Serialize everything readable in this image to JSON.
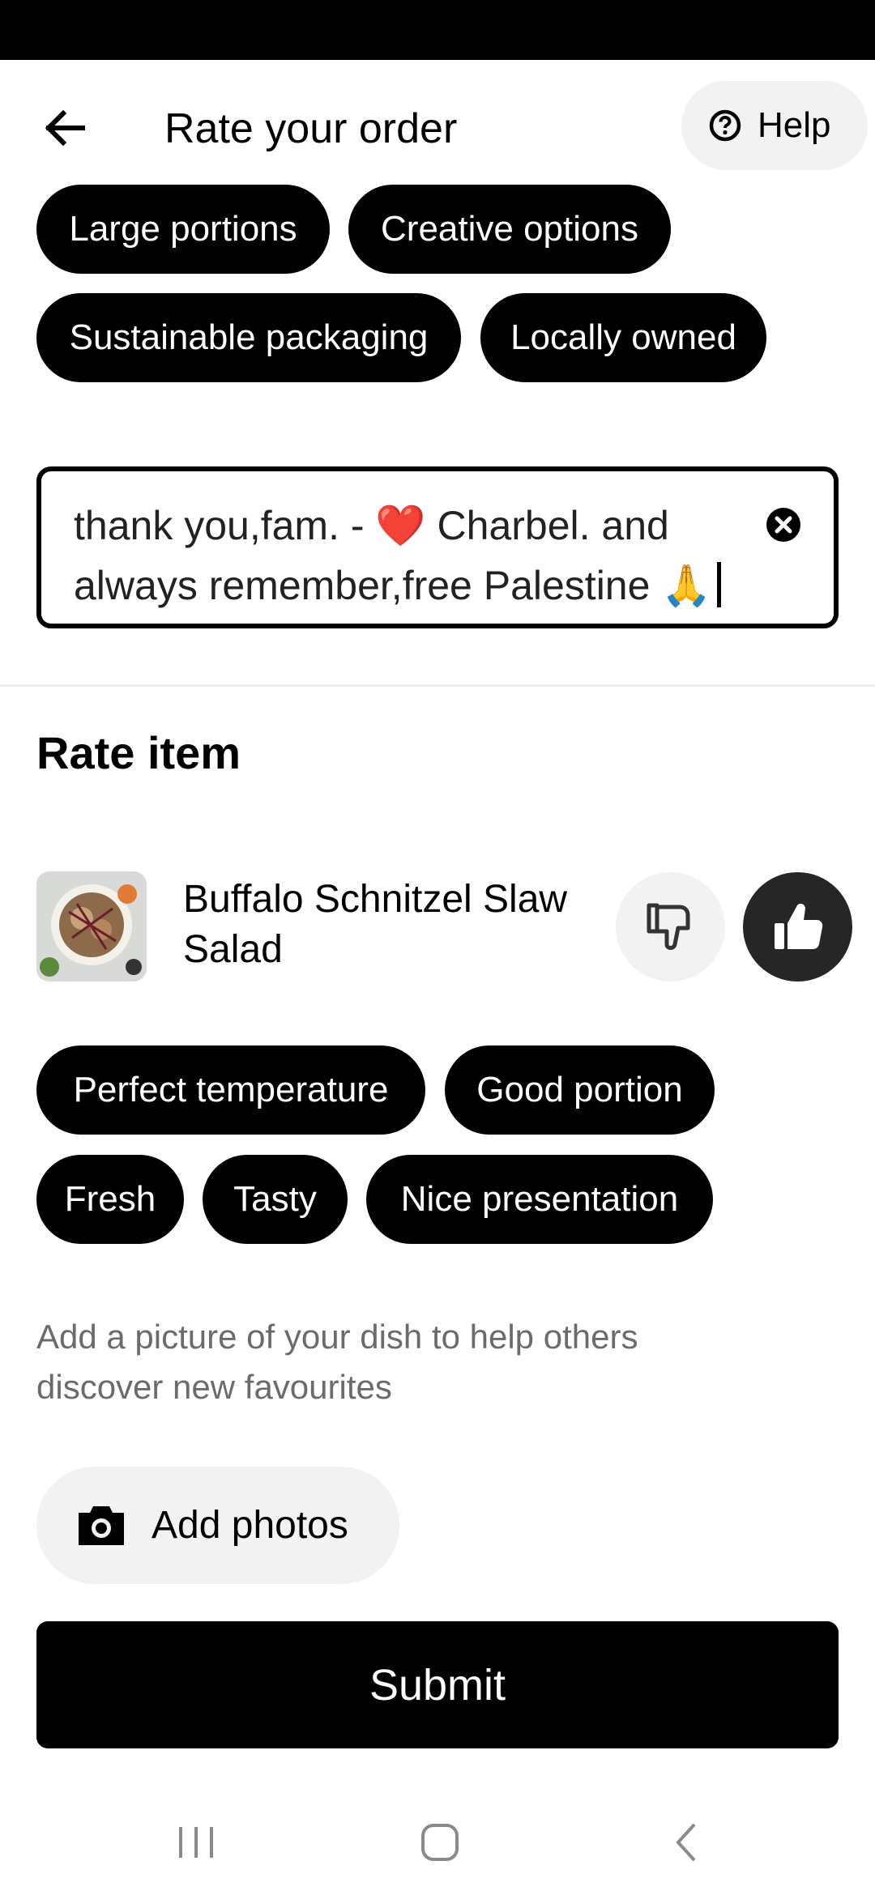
{
  "header": {
    "title": "Rate your order",
    "help_label": "Help"
  },
  "restaurant_tags": [
    {
      "label": "Large portions"
    },
    {
      "label": "Creative options"
    },
    {
      "label": "Sustainable packaging"
    },
    {
      "label": "Locally owned"
    }
  ],
  "comment": {
    "value": "thank you,fam. - ❤️ Charbel. and always remember,free Palestine 🙏"
  },
  "rate_item": {
    "section_title": "Rate item",
    "item_name": "Buffalo Schnitzel Slaw Salad",
    "rating": "thumbs-up",
    "tags": [
      {
        "label": "Perfect temperature"
      },
      {
        "label": "Good portion"
      },
      {
        "label": "Fresh"
      },
      {
        "label": "Tasty"
      },
      {
        "label": "Nice presentation"
      }
    ],
    "photo_hint": "Add a picture of your dish to help others discover new favourites",
    "add_photos_label": "Add photos"
  },
  "submit_label": "Submit",
  "colors": {
    "primary": "#000000",
    "chip_bg": "#000000",
    "secondary_bg": "#f2f2f2",
    "thumb_up_bg": "#262626",
    "hint_text": "#6b6b6b"
  }
}
